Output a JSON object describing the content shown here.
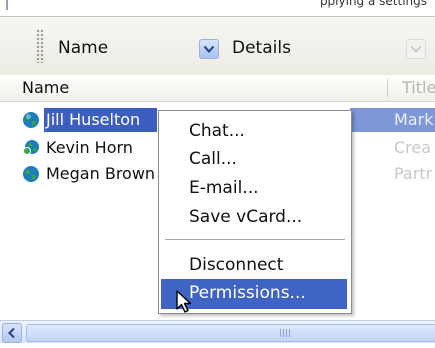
{
  "top_strip": {
    "text": "pplying a settings"
  },
  "toolbar": {
    "sort_by": "Name",
    "view_mode": "Details"
  },
  "list_header": {
    "name_col": "Name",
    "title_col": "Title"
  },
  "contacts": [
    {
      "name": "Jill Huselton",
      "side_text": "Mark",
      "selected": true
    },
    {
      "name": "Kevin Horn",
      "side_text": "Crea",
      "selected": false
    },
    {
      "name": "Megan Brown",
      "side_text": "Partr",
      "selected": false
    }
  ],
  "context_menu": {
    "items": [
      "Chat...",
      "Call...",
      "E-mail...",
      "Save vCard...",
      "Disconnect",
      "Permissions..."
    ],
    "highlighted": "Permissions..."
  },
  "scrollbar": {
    "grip": "III"
  },
  "colors": {
    "selection": "#3c5fbf",
    "menu_highlight": "#3f64c4"
  },
  "icons": [
    "globe-contact-icon",
    "contact-online-icon",
    "chevron-down-icon",
    "arrow-left-icon",
    "mouse-pointer-icon"
  ]
}
